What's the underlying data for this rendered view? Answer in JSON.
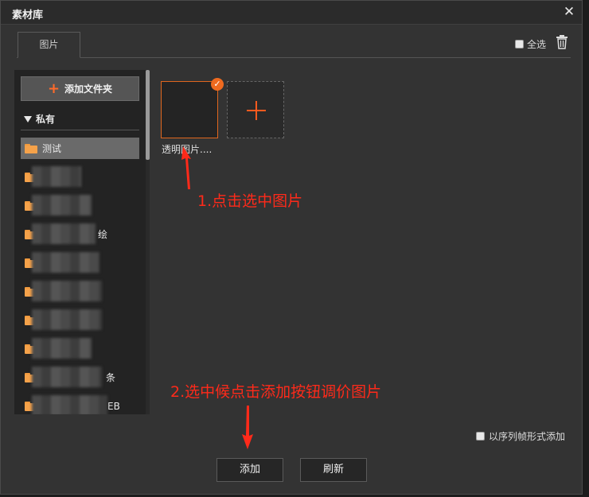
{
  "dialog": {
    "title": "素材库",
    "close_glyph": "✕"
  },
  "tabs": [
    {
      "label": "图片",
      "active": true
    }
  ],
  "toolbar": {
    "select_all_label": "全选",
    "delete_icon": "trash-icon"
  },
  "sidebar": {
    "add_folder_label": "添加文件夹",
    "section_label": "私有",
    "folders": [
      {
        "label": "测试",
        "selected": true
      },
      {
        "label": ""
      },
      {
        "label": ""
      },
      {
        "label": "绘"
      },
      {
        "label": ""
      },
      {
        "label": ""
      },
      {
        "label": ""
      },
      {
        "label": ""
      },
      {
        "label": "条"
      },
      {
        "label": "EB"
      }
    ]
  },
  "images": [
    {
      "label": "透明图片....",
      "selected": true
    }
  ],
  "annotations": {
    "step1": "1.点击选中图片",
    "step2": "2.选中候点击添加按钮调价图片"
  },
  "options": {
    "sequence_label": "以序列帧形式添加"
  },
  "buttons": {
    "add_label": "添加",
    "refresh_label": "刷新"
  },
  "colors": {
    "accent": "#ef6a1f",
    "annotation": "#ff2a1a",
    "folder": "#f5a24a"
  }
}
